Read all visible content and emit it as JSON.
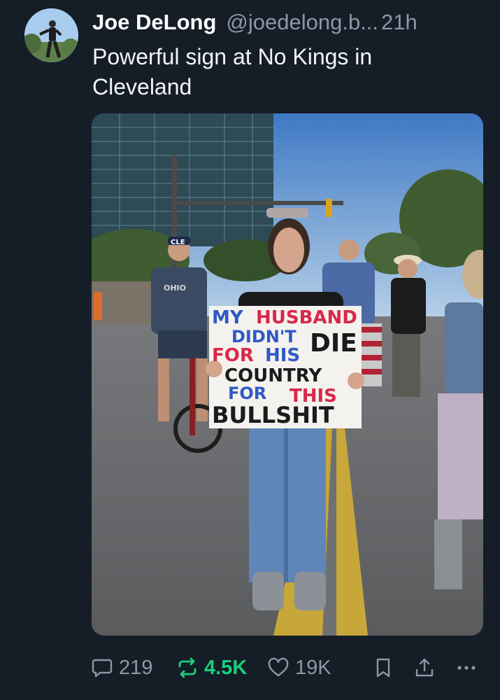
{
  "post": {
    "author": {
      "display_name": "Joe DeLong",
      "handle": "@joedelong.b...",
      "time": "21h"
    },
    "text": "Powerful sign at No Kings in Cleveland",
    "image": {
      "sign_lines": [
        [
          "MY",
          "HUSBAND"
        ],
        [
          "DIDN'T",
          "DIE"
        ],
        [
          "FOR",
          "HIS"
        ],
        [
          "COUNTRY"
        ],
        [
          "FOR",
          "THIS"
        ],
        [
          "BULLSHIT"
        ]
      ],
      "cap_text": "CLE",
      "shirt_text": "OHIO"
    },
    "stats": {
      "replies": "219",
      "reposts": "4.5K",
      "likes": "19K"
    }
  },
  "icons": {
    "reply": "reply-bubble-icon",
    "repost": "repost-arrows-icon",
    "like": "heart-icon",
    "bookmark": "bookmark-icon",
    "share": "share-upload-icon",
    "more": "more-dots-icon"
  },
  "colors": {
    "background": "#151d27",
    "text": "#f2f4f7",
    "muted": "#8b98a5",
    "repost_active": "#19d07a",
    "sign_blue": "#2f58c9",
    "sign_red": "#d8284a",
    "sign_black": "#1b1b1b"
  }
}
